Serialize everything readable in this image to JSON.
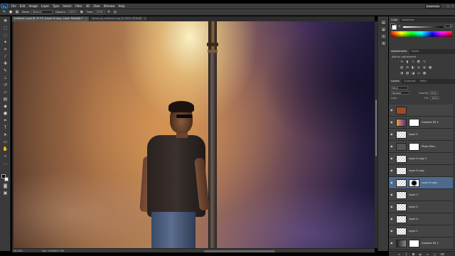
{
  "app": {
    "logo": "Ps",
    "menu": [
      "File",
      "Edit",
      "Image",
      "Layer",
      "Type",
      "Select",
      "Filter",
      "3D",
      "View",
      "Window",
      "Help"
    ],
    "workspace": "Essentials"
  },
  "options_bar": {
    "mode_label": "Mode:",
    "mode_value": "Normal",
    "opacity_label": "Opacity:",
    "opacity_value": "100%",
    "flow_label": "Flow:",
    "flow_value": "100%"
  },
  "tabs": [
    {
      "label": "Untitled-1.psd @ 33.3% (Layer 6 copy, Layer Mask/8) *",
      "close": "×"
    },
    {
      "label": "shoot_by_shikarshi.jpg @ 100% (RGB/8)",
      "close": "×"
    }
  ],
  "status": {
    "zoom": "33.33%",
    "doc": "Doc: 6.59M/27.9M"
  },
  "panels": {
    "color_tabs": [
      "Color",
      "Swatches"
    ],
    "k_label": "K",
    "k_value": "0",
    "adjustments_tabs": [
      "Adjustments",
      "Styles"
    ],
    "adjustments_title": "Add an adjustment",
    "layers_tabs": [
      "Layers",
      "Channels",
      "Paths"
    ],
    "kind_label": "Kind",
    "blend_mode": "Normal",
    "opacity_label": "Opacity:",
    "opacity_value": "100%",
    "lock_label": "Lock:",
    "fill_label": "Fill:",
    "fill_value": "100%",
    "layers": [
      {
        "name": "",
        "type": "folder"
      },
      {
        "name": "Gradient Fill 2",
        "type": "gradient"
      },
      {
        "name": "Layer 5",
        "type": "pixel"
      },
      {
        "name": "Photo Fiter...",
        "type": "adjustment"
      },
      {
        "name": "Layer 4 copy 2",
        "type": "pixel"
      },
      {
        "name": "Layer 6 copy",
        "type": "pixel"
      },
      {
        "name": "Layer 6 copy",
        "type": "pixel",
        "selected": true
      },
      {
        "name": "Layer 3",
        "type": "pixel"
      },
      {
        "name": "Layer 4",
        "type": "pixel"
      },
      {
        "name": "Layer 4",
        "type": "pixel"
      },
      {
        "name": "Layer 2",
        "type": "pixel"
      },
      {
        "name": "Gradient Fill 1",
        "type": "gradient"
      }
    ]
  },
  "colors": {
    "panel_bg": "#3a3a3a",
    "selected_layer": "#4d6a8c",
    "accent": "#2e7ac0"
  }
}
